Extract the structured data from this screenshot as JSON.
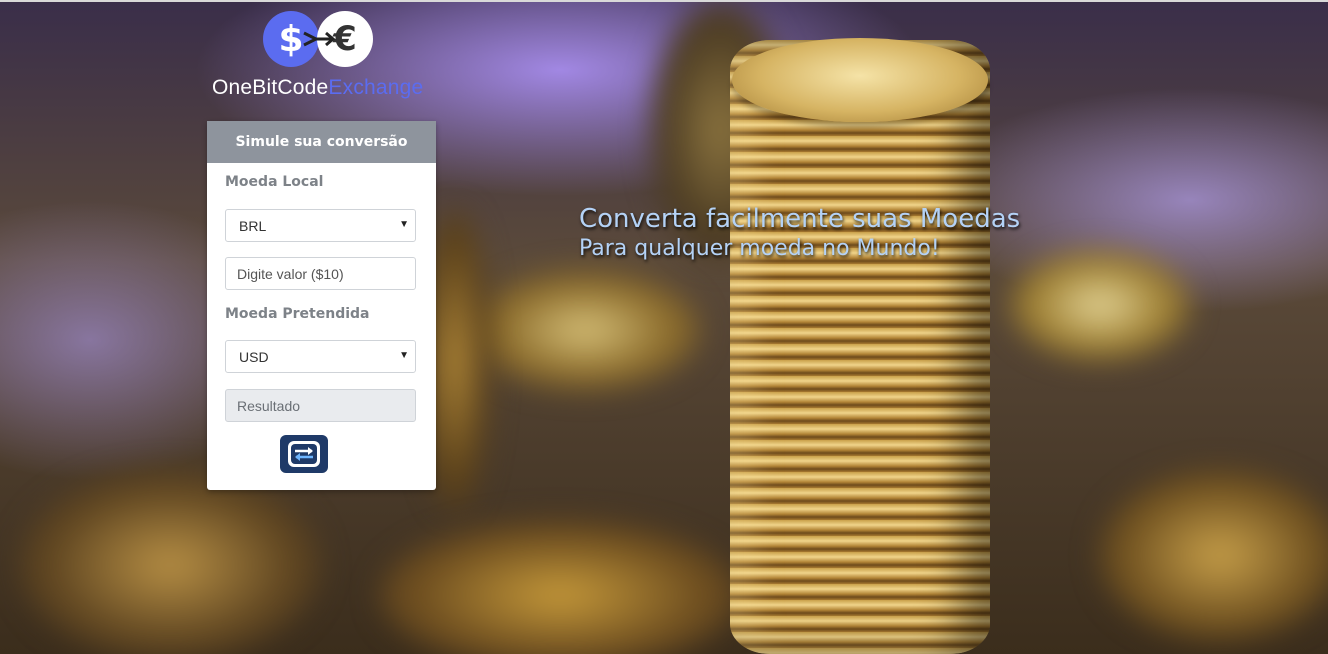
{
  "brand": {
    "dollar_symbol": "$",
    "euro_symbol": "€",
    "name_part1": "OneBitCode",
    "name_part2": "Exchange",
    "accent_color": "#5b6cf0"
  },
  "converter": {
    "header": "Simule sua conversão",
    "local_currency_label": "Moeda Local",
    "local_currency_selected": "BRL",
    "amount_placeholder": "Digite valor ($10)",
    "target_currency_label": "Moeda Pretendida",
    "target_currency_selected": "USD",
    "result_placeholder": "Resultado",
    "convert_icon": "exchange-arrows-icon"
  },
  "hero": {
    "line1": "Converta facilmente suas Moedas",
    "line2": "Para qualquer moeda no Mundo!"
  },
  "colors": {
    "card_header": "#8e949d",
    "button": "#1f3a68",
    "tagline": "#b4d2f6"
  }
}
